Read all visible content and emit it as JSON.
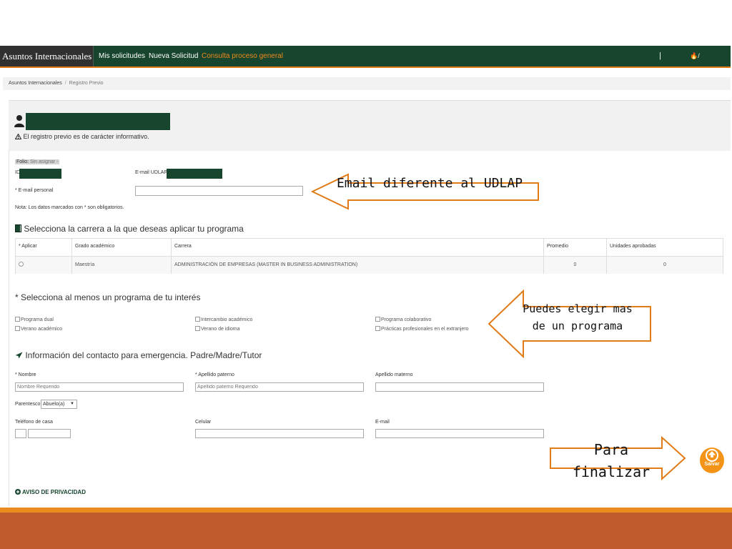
{
  "navbar": {
    "brand": "Asuntos Internacionales",
    "links": [
      "Mis solicitudes",
      "Nueva Solicitud",
      "Consulta proceso general"
    ],
    "right_text": "|",
    "right_icons": "🔥/"
  },
  "breadcrumb": [
    "Asuntos Internacionales",
    "/",
    "Registro Previo"
  ],
  "header": {
    "info_text": "El registro previo es de carácter informativo."
  },
  "form": {
    "folio_label": "Folio:",
    "folio_value": "Sin asignar -",
    "id_label": "ID",
    "email_udlap_label": "E-mail UDLAP:",
    "email_personal_label": "* E-mail personal",
    "email_personal_value": "",
    "note": "Nota: Los datos marcados con * son obligatorios."
  },
  "career_section": {
    "title": "Selecciona la carrera a la que deseas aplicar tu programa",
    "columns": [
      "* Aplicar",
      "Grado académico",
      "Carrera",
      "Promedio",
      "Unidades aprobadas"
    ],
    "rows": [
      {
        "grado": "Maestría",
        "carrera": "ADMINISTRACIÓN DE EMPRESAS (MASTER IN BUSINESS ADMINISTRATION)",
        "promedio": "0",
        "unidades": "0"
      }
    ]
  },
  "program_section": {
    "title": "* Selecciona al menos un programa de tu interés",
    "options": [
      "Programa dual",
      "Verano académico",
      "Intercambio académico",
      "Verano de idioma",
      "Programa colaborativo",
      "Prácticas profesionales en el extranjero"
    ]
  },
  "emergency_section": {
    "title": "Información del contacto para emergencia. Padre/Madre/Tutor",
    "nombre_label": "* Nombre",
    "nombre_placeholder": "Nombre Requerido",
    "apellido_paterno_label": "* Apellido paterno",
    "apellido_paterno_placeholder": "Apellido paterno Requerido",
    "apellido_materno_label": "Apellido materno",
    "parentesco_label": "Parentesco",
    "parentesco_value": "Abuelo(a)",
    "telefono_label": "Teléfono de casa",
    "celular_label": "Celular",
    "email_label": "E-mail"
  },
  "privacy_link": "AVISO DE PRIVACIDAD",
  "save_button": "Salvar",
  "annotations": {
    "email": "Email diferente al UDLAP",
    "programs": "Puedes elegir mas de un programa",
    "finish": "Para finalizar"
  },
  "colors": {
    "nav_green": "#17452e",
    "accent_orange": "#e07b17",
    "bottom_bar": "#bf5a2c",
    "save_button": "#f39419"
  }
}
